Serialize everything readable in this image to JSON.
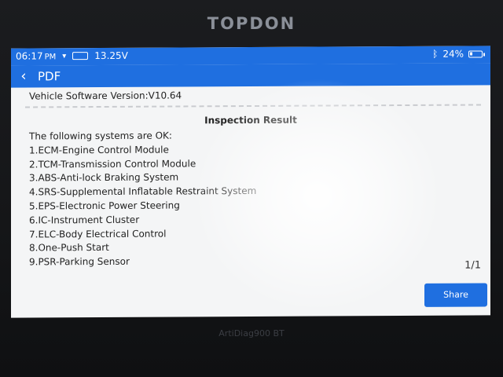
{
  "device": {
    "brand": "TOPDON",
    "model_label": "ArtiDiag900 BT"
  },
  "status_bar": {
    "time": "06:17",
    "ampm": "PM",
    "voltage": "13.25V",
    "battery_percent": "24%",
    "battery_level": 0.24,
    "icons": [
      "wifi-icon",
      "vci-icon",
      "bluetooth-icon",
      "battery-icon"
    ]
  },
  "nav": {
    "title": "PDF",
    "back_icon": "chevron-left-icon"
  },
  "report": {
    "version_line": "Vehicle Software Version:V10.64",
    "result_title": "Inspection Result",
    "intro": "The following systems are OK:",
    "systems": [
      "1.ECM-Engine Control Module",
      "2.TCM-Transmission Control Module",
      "3.ABS-Anti-lock Braking System",
      "4.SRS-Supplemental Inflatable Restraint System",
      "5.EPS-Electronic Power Steering",
      "6.IC-Instrument Cluster",
      "7.ELC-Body Electrical Control",
      "8.One-Push Start",
      "9.PSR-Parking Sensor"
    ],
    "page_indicator": "1/1"
  },
  "actions": {
    "share_label": "Share"
  },
  "colors": {
    "accent": "#1f6fe0",
    "screen_bg": "#f4f5f6",
    "text": "#222222"
  }
}
